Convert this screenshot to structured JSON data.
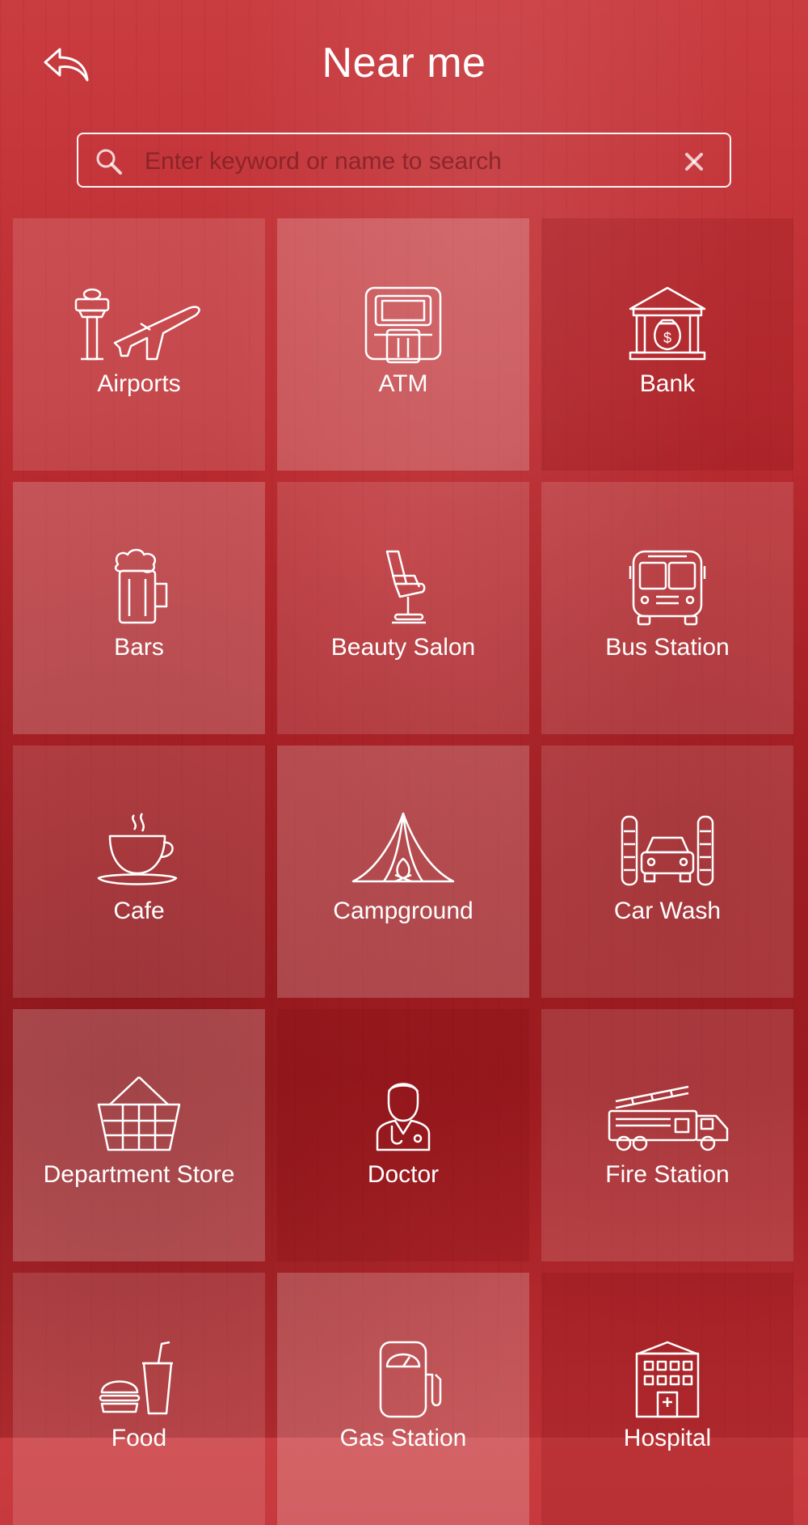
{
  "header": {
    "title": "Near me",
    "back_icon": "back-arrow-icon"
  },
  "search": {
    "placeholder": "Enter keyword or name to search",
    "value": "",
    "search_icon": "search-icon",
    "clear_icon": "close-icon"
  },
  "categories": [
    {
      "label": "Airports",
      "icon": "airport-icon"
    },
    {
      "label": "ATM",
      "icon": "atm-icon"
    },
    {
      "label": "Bank",
      "icon": "bank-icon"
    },
    {
      "label": "Bars",
      "icon": "beer-mug-icon"
    },
    {
      "label": "Beauty Salon",
      "icon": "salon-chair-icon"
    },
    {
      "label": "Bus Station",
      "icon": "bus-icon"
    },
    {
      "label": "Cafe",
      "icon": "coffee-cup-icon"
    },
    {
      "label": "Campground",
      "icon": "tent-icon"
    },
    {
      "label": "Car Wash",
      "icon": "car-wash-icon"
    },
    {
      "label": "Department Store",
      "icon": "basket-icon"
    },
    {
      "label": "Doctor",
      "icon": "doctor-icon"
    },
    {
      "label": "Fire Station",
      "icon": "fire-truck-icon"
    },
    {
      "label": "Food",
      "icon": "burger-drink-icon"
    },
    {
      "label": "Gas Station",
      "icon": "gas-pump-icon"
    },
    {
      "label": "Hospital",
      "icon": "hospital-icon"
    }
  ],
  "colors": {
    "background": "#b8272c",
    "text": "#ffffff"
  }
}
